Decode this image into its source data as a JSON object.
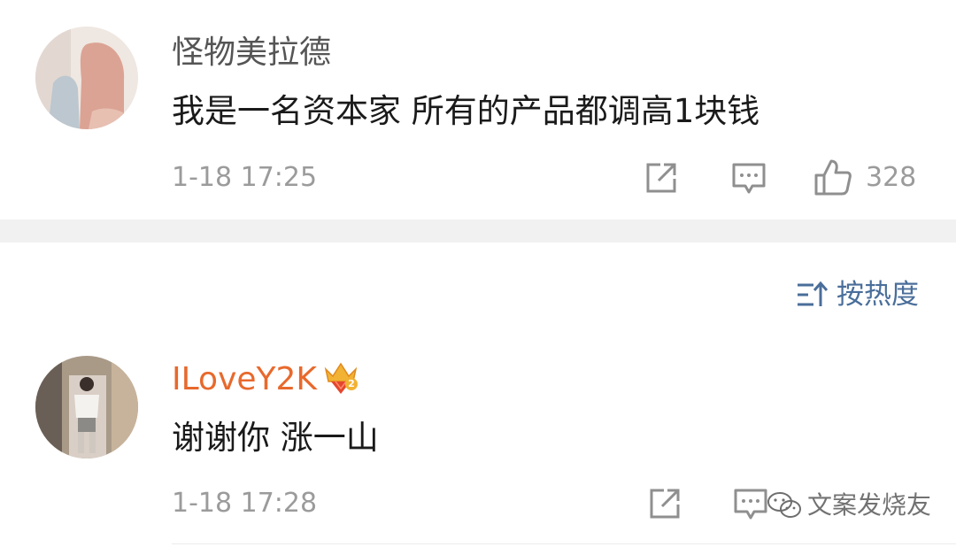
{
  "comments": [
    {
      "username": "怪物美拉德",
      "text": "我是一名资本家 所有的产品都调高1块钱",
      "time": "1-18 17:25",
      "likes": "328",
      "username_color": "#555555"
    },
    {
      "username": "ILoveY2K",
      "text": "谢谢你 涨一山",
      "time": "1-18 17:28",
      "username_color": "#e8692c",
      "badge_icon": "crown-gem-badge-icon",
      "badge_level": "2"
    }
  ],
  "sort": {
    "label": "按热度",
    "icon": "sort-icon",
    "color": "#4a6e9a"
  },
  "watermark": {
    "text": "文案发烧友"
  }
}
